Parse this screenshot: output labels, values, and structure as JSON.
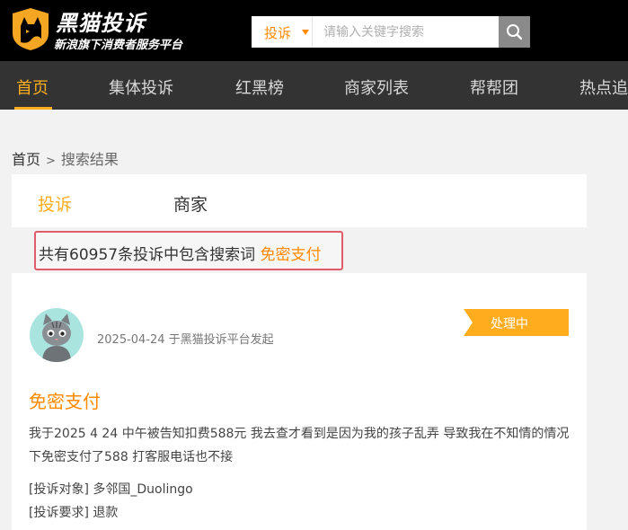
{
  "header": {
    "brand_title": "黑猫投诉",
    "brand_subtitle": "新浪旗下消费者服务平台",
    "search": {
      "type_label": "投诉",
      "placeholder": "请输入关键字搜索"
    }
  },
  "nav": {
    "items": [
      {
        "label": "首页"
      },
      {
        "label": "集体投诉"
      },
      {
        "label": "红黑榜"
      },
      {
        "label": "商家列表"
      },
      {
        "label": "帮帮团"
      },
      {
        "label": "热点追"
      }
    ],
    "active_index": 0
  },
  "breadcrumb": {
    "home": "首页",
    "separator": ">",
    "current": "搜索结果"
  },
  "tabs": {
    "complaints": "投诉",
    "merchants": "商家"
  },
  "results": {
    "prefix": "共有60957条投诉中包含搜索词 ",
    "keyword": "免密支付"
  },
  "card": {
    "date": "2025-04-24 于黑猫投诉平台发起",
    "status": "处理中",
    "title": "免密支付",
    "description": "我于2025 4 24 中午被告知扣费588元 我去查才看到是因为我的孩子乱弄 导致我在不知情的情况下免密支付了588 打客服电话也不接",
    "target_label": "[投诉对象]",
    "target_value": " 多邻国_Duolingo",
    "demand_label": "[投诉要求]",
    "demand_value": " 退款"
  },
  "colors": {
    "accent": "#ffad1f",
    "orange": "#ff8a00",
    "highlight_border": "#e05c6a",
    "topbar": "#000000",
    "navbar": "#333333"
  }
}
